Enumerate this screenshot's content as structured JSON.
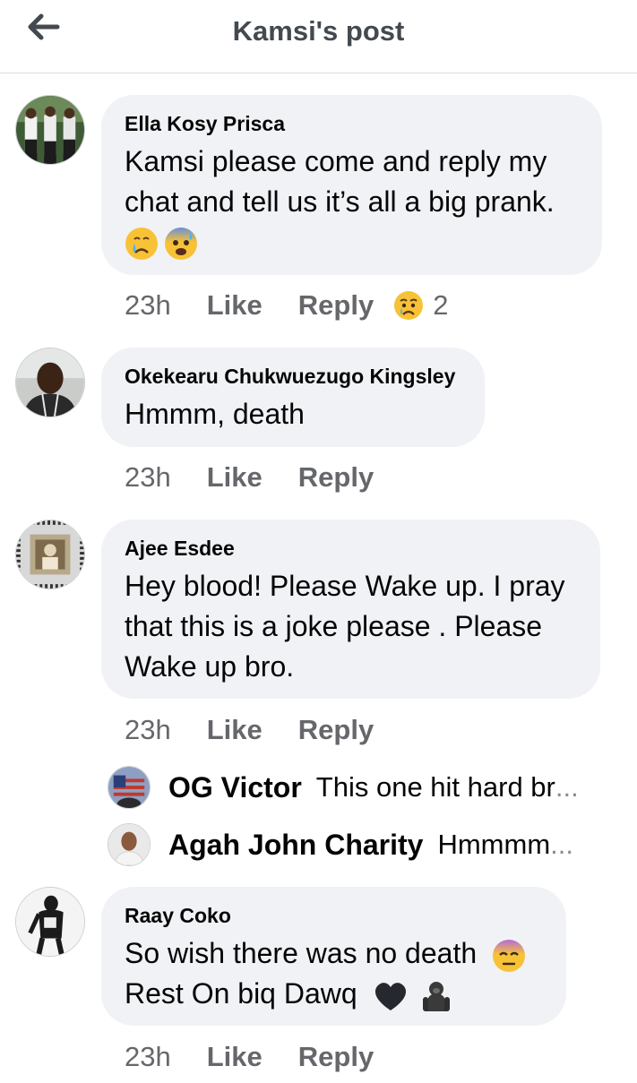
{
  "header": {
    "title": "Kamsi's post"
  },
  "icons": {
    "back": "arrow-left-icon"
  },
  "comments": [
    {
      "author": "Ella Kosy Prisca",
      "text": "Kamsi please come and reply my chat and tell us it’s all a big prank.",
      "emojis": [
        "crying-face-emoji",
        "anxious-face-with-sweat-emoji"
      ],
      "time": "23h",
      "like": "Like",
      "reply": "Reply",
      "reaction": {
        "type": "sad",
        "count": "2"
      }
    },
    {
      "author": "Okekearu Chukwuezugo Kingsley",
      "text": "Hmmm, death",
      "time": "23h",
      "like": "Like",
      "reply": "Reply"
    },
    {
      "author": "Ajee Esdee",
      "text": "Hey blood! Please Wake up. I pray that this is a joke please . Please Wake up bro.",
      "time": "23h",
      "like": "Like",
      "reply": "Reply",
      "replies": [
        {
          "author": "OG Victor",
          "text": "This one hit hard br",
          "ellipsis": "..."
        },
        {
          "author": "Agah John Charity",
          "text": "Hmmmm",
          "ellipsis": "..."
        }
      ]
    },
    {
      "author": "Raay Coko",
      "text_line1": "So wish there was no death",
      "text_line2": "Rest On biq Dawq",
      "emojis": [
        "face-with-rolling-eyes-emoji",
        "black-heart-emoji",
        "gorilla-emoji"
      ],
      "time": "23h",
      "like": "Like",
      "reply": "Reply"
    }
  ],
  "colors": {
    "bubble": "#f0f2f5",
    "meta": "#65676b",
    "title": "#444950"
  }
}
